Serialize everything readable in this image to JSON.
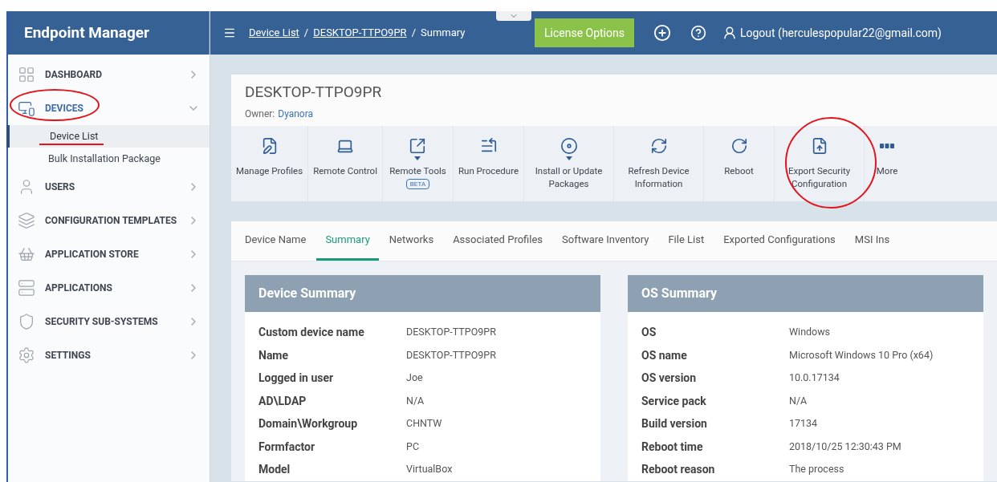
{
  "app_title": "Endpoint Manager",
  "breadcrumb": [
    {
      "label": "Device List",
      "link": true
    },
    {
      "separator": "/",
      "label": "DESKTOP-TTPO9PR",
      "link": true
    },
    {
      "separator": "/",
      "label": "Summary",
      "link": false
    }
  ],
  "header": {
    "license_button": "License Options",
    "user": "Logout (herculespopular22@gmail.com)"
  },
  "sidebar": {
    "items": [
      {
        "label": "DASHBOARD",
        "selected": false,
        "expanded": false
      },
      {
        "label": "DEVICES",
        "selected": true,
        "expanded": true,
        "children": [
          {
            "label": "Device List",
            "selected": true
          },
          {
            "label": "Bulk Installation Package",
            "selected": false
          }
        ]
      },
      {
        "label": "USERS",
        "selected": false,
        "expanded": false
      },
      {
        "label": "CONFIGURATION TEMPLATES",
        "selected": false,
        "expanded": false
      },
      {
        "label": "APPLICATION STORE",
        "selected": false,
        "expanded": false
      },
      {
        "label": "APPLICATIONS",
        "selected": false,
        "expanded": false
      },
      {
        "label": "SECURITY SUB-SYSTEMS",
        "selected": false,
        "expanded": false
      },
      {
        "label": "SETTINGS",
        "selected": false,
        "expanded": false
      }
    ]
  },
  "device": {
    "name": "DESKTOP-TTPO9PR",
    "owner_label": "Owner:",
    "owner": "Dyanora"
  },
  "toolbar": [
    {
      "label": "Manage Profiles",
      "dropdown": false
    },
    {
      "label": "Remote Control",
      "dropdown": false
    },
    {
      "label": "Remote Tools",
      "dropdown": true,
      "badge": "BETA"
    },
    {
      "label": "Run Procedure",
      "dropdown": false
    },
    {
      "label": "Install or Update Packages",
      "dropdown": true
    },
    {
      "label": "Refresh Device Information",
      "dropdown": false
    },
    {
      "label": "Reboot",
      "dropdown": false
    },
    {
      "label": "Export Security Configuration",
      "dropdown": false
    },
    {
      "label": "More",
      "dropdown": false
    }
  ],
  "tabs": [
    {
      "label": "Device Name",
      "selected": false
    },
    {
      "label": "Summary",
      "selected": true
    },
    {
      "label": "Networks",
      "selected": false
    },
    {
      "label": "Associated Profiles",
      "selected": false
    },
    {
      "label": "Software Inventory",
      "selected": false
    },
    {
      "label": "File List",
      "selected": false
    },
    {
      "label": "Exported Configurations",
      "selected": false
    },
    {
      "label": "MSI Ins",
      "selected": false
    }
  ],
  "panels": [
    {
      "title": "Device Summary",
      "rows": [
        {
          "label": "Custom device name",
          "value": "DESKTOP-TTPO9PR"
        },
        {
          "label": "Name",
          "value": "DESKTOP-TTPO9PR"
        },
        {
          "label": "Logged in user",
          "value": "Joe"
        },
        {
          "label": "AD\\LDAP",
          "value": "N/A"
        },
        {
          "label": "Domain\\Workgroup",
          "value": "CHNTW"
        },
        {
          "label": "Formfactor",
          "value": "PC"
        },
        {
          "label": "Model",
          "value": "VirtualBox"
        }
      ]
    },
    {
      "title": "OS Summary",
      "rows": [
        {
          "label": "OS",
          "value": "Windows"
        },
        {
          "label": "OS name",
          "value": "Microsoft Windows 10 Pro (x64)"
        },
        {
          "label": "OS version",
          "value": "10.0.17134"
        },
        {
          "label": "Service pack",
          "value": "N/A"
        },
        {
          "label": "Build version",
          "value": "17134"
        },
        {
          "label": "Reboot time",
          "value": "2018/10/25 12:30:43 PM"
        },
        {
          "label": "Reboot reason",
          "value": "The process"
        }
      ]
    }
  ]
}
